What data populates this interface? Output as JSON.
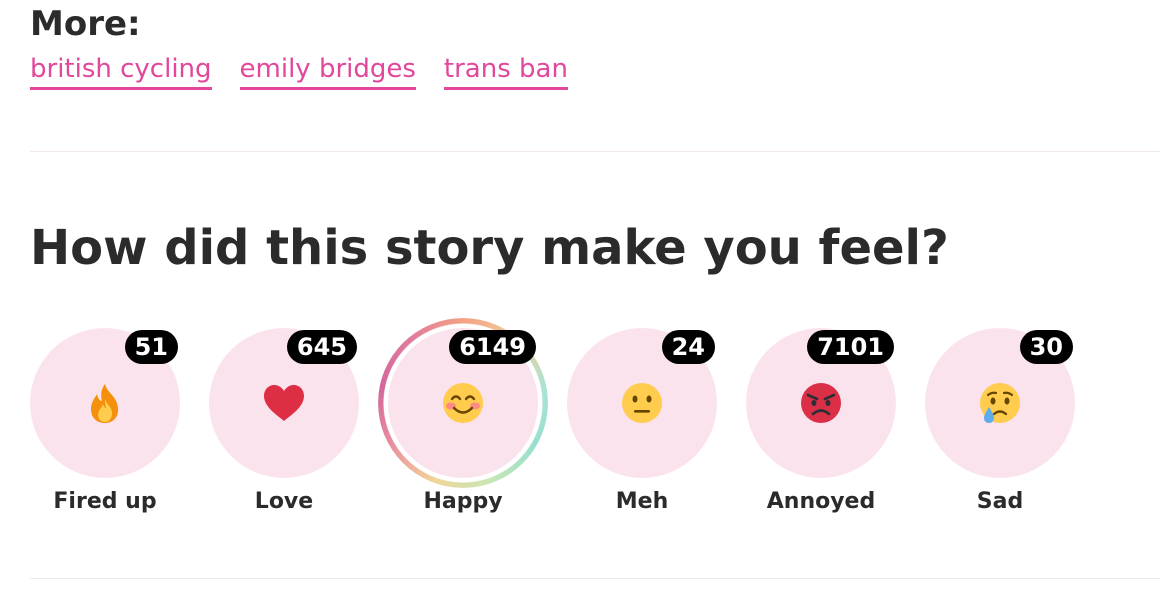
{
  "more": {
    "title": "More:",
    "tags": [
      "british cycling",
      "emily bridges",
      "trans ban"
    ]
  },
  "feelings": {
    "heading": "How did this story make you feel?",
    "reactions": [
      {
        "label": "Fired up",
        "count": "51",
        "icon": "fire-icon"
      },
      {
        "label": "Love",
        "count": "645",
        "icon": "heart-icon"
      },
      {
        "label": "Happy",
        "count": "6149",
        "icon": "smiling-face-icon",
        "selected": true
      },
      {
        "label": "Meh",
        "count": "24",
        "icon": "neutral-face-icon"
      },
      {
        "label": "Annoyed",
        "count": "7101",
        "icon": "angry-face-icon"
      },
      {
        "label": "Sad",
        "count": "30",
        "icon": "crying-face-icon"
      }
    ]
  },
  "colors": {
    "link": "#e2479a",
    "bubble": "#fbe3ee",
    "text": "#2b2b2b",
    "badge": "#000000"
  }
}
